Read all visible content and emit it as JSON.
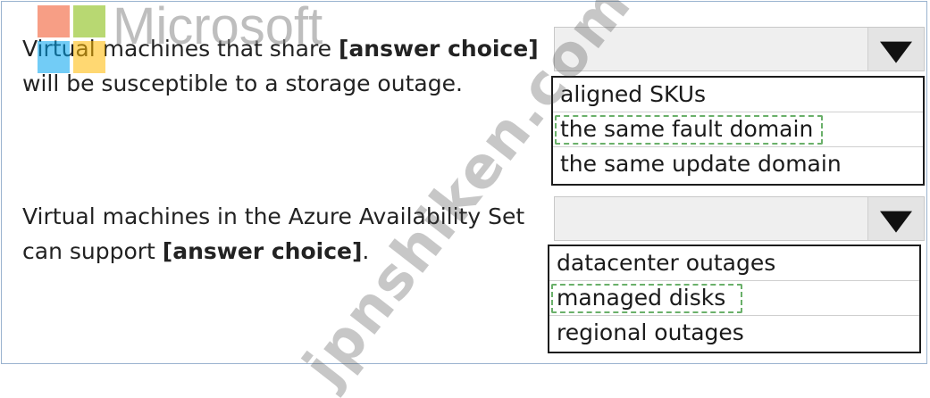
{
  "questions": [
    {
      "line1_prefix": "Virtual machines that share ",
      "line1_choice": "[answer choice]",
      "line2": "will be susceptible to a storage outage.",
      "options": [
        "aligned SKUs",
        "the same fault domain",
        "the same update domain"
      ],
      "highlighted_option": "the same fault domain"
    },
    {
      "line1": "Virtual machines in the Azure Availability Set",
      "line2_prefix": "can support ",
      "line2_choice": "[answer choice]",
      "line2_suffix": ".",
      "options": [
        "datacenter outages",
        "managed disks",
        "regional outages"
      ],
      "highlighted_option": "managed disks"
    }
  ],
  "watermark": {
    "logo_text": "Microsoft",
    "site_text": "jpnshiken.com"
  },
  "colors": {
    "highlight_dash": "#6ab06a",
    "dropdown_bg": "#efefef",
    "frame_border": "#9ab3cf"
  }
}
